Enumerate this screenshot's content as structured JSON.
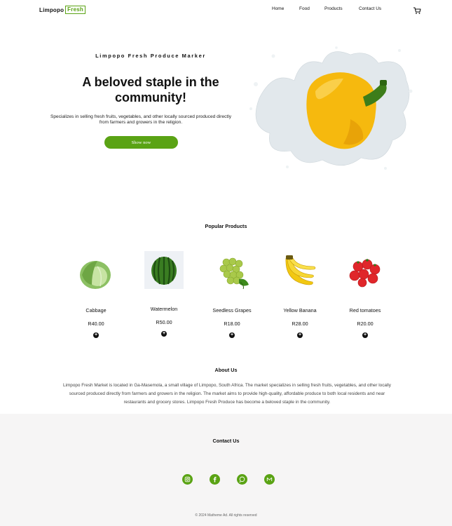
{
  "brand": {
    "part1": "Limpopo",
    "part2": "Fresh"
  },
  "nav": {
    "home": "Home",
    "food": "Food",
    "products": "Products",
    "contact": "Contact Us"
  },
  "hero": {
    "eyebrow": "Limpopo Fresh Produce Marker",
    "title": "A beloved staple in the community!",
    "description": "Specializes in selling fresh fruits, vegetables, and other locally sourced produced directly from farmers and growers in the religion.",
    "button": "Show now"
  },
  "products": {
    "title": "Popular Products",
    "items": [
      {
        "name": "Cabbage",
        "price": "R40.00"
      },
      {
        "name": "Watermelon",
        "price": "R50.00"
      },
      {
        "name": "Seedless Grapes",
        "price": "R18.00"
      },
      {
        "name": "Yellow Banana",
        "price": "R28.00"
      },
      {
        "name": "Red tomatoes",
        "price": "R20.00"
      }
    ]
  },
  "about": {
    "title": "About Us",
    "text": "Limpopo Fresh Market is located in Ga-Masemola, a small village of Limpopo, South Africa. The market specializes in selling fresh fruits, vegetables, and other locally sourced produced directly from farmers and growers in the religion. The market aims to provide high-quality, affordable produce to both local residents and near restaurants and grocery stores. Limpopo Fresh Produce has become a beloved staple in the community."
  },
  "contact": {
    "title": "Contact Us",
    "icons": [
      "instagram-icon",
      "facebook-icon",
      "whatsapp-icon",
      "mail-icon"
    ]
  },
  "footer": {
    "copyright": "© 2024 Matheme Ad. All rights reserved"
  },
  "colors": {
    "accent": "#5aa314",
    "contact_bg": "#f6f5f5"
  }
}
